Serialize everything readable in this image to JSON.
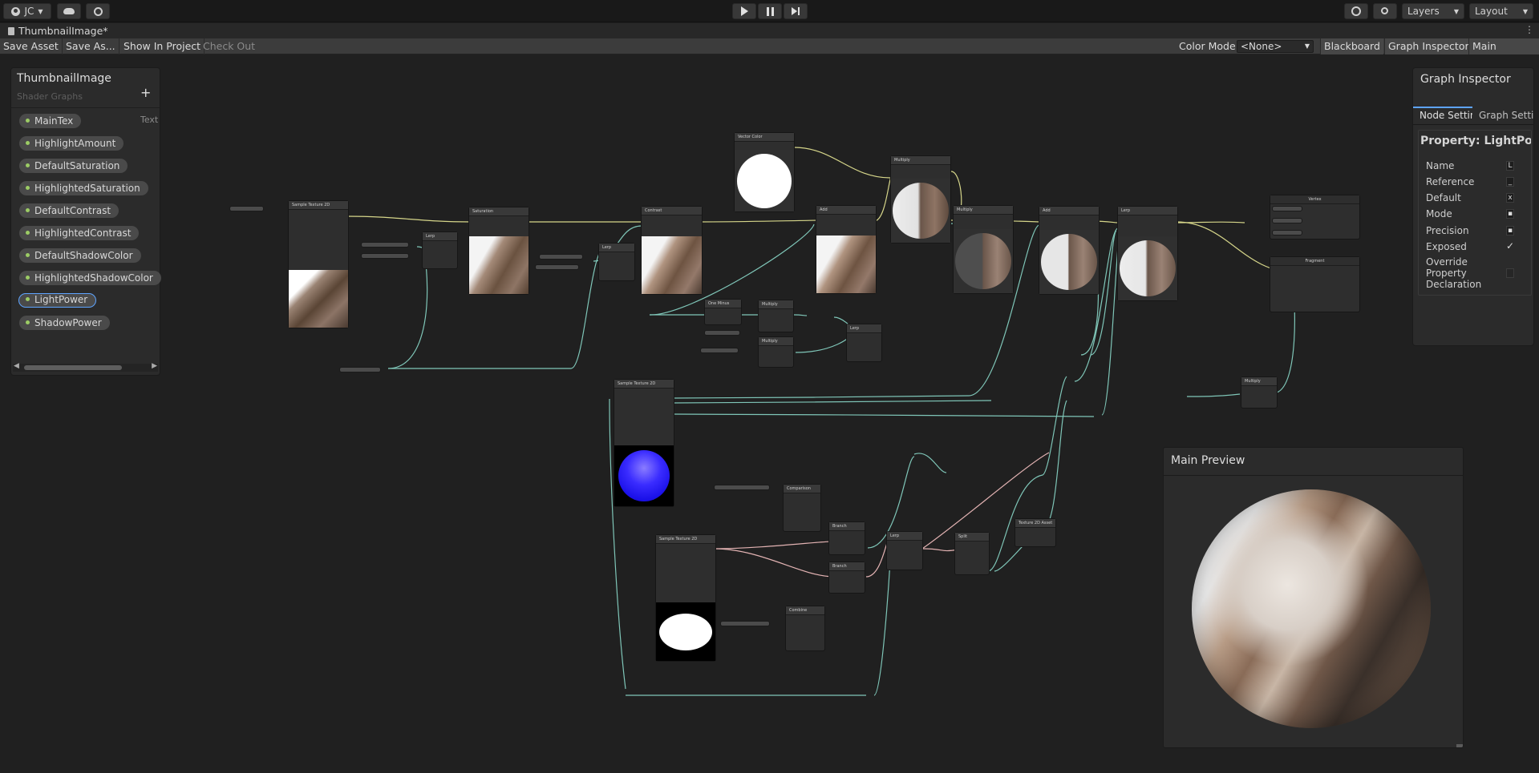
{
  "topbar": {
    "account": "JC",
    "layers": "Layers",
    "layout": "Layout"
  },
  "tab": {
    "title": "ThumbnailImage*"
  },
  "toolbar": {
    "save_asset": "Save Asset",
    "save_as": "Save As...",
    "show_in_project": "Show In Project",
    "check_out": "Check Out",
    "color_mode_label": "Color Mode",
    "color_mode_value": "<None>",
    "blackboard": "Blackboard",
    "graph_inspector": "Graph Inspector",
    "main_preview": "Main Preview"
  },
  "blackboard": {
    "title": "ThumbnailImage",
    "subtitle": "Shader Graphs",
    "type_hint": "Text",
    "properties": [
      "MainTex",
      "HighlightAmount",
      "DefaultSaturation",
      "HighlightedSaturation",
      "DefaultContrast",
      "HighlightedContrast",
      "DefaultShadowColor",
      "HighlightedShadowColor",
      "LightPower",
      "ShadowPower"
    ],
    "selected": "LightPower"
  },
  "inspector": {
    "title": "Graph Inspector",
    "tabs": [
      "Node Settings",
      "Graph Settings"
    ],
    "property_title": "Property: LightPower",
    "rows": [
      "Name",
      "Reference",
      "Default",
      "Mode",
      "Precision",
      "Exposed",
      "Override Property Declaration"
    ],
    "values": [
      "L",
      "_",
      "x",
      "▪",
      "▪",
      "✓",
      ""
    ]
  },
  "preview": {
    "title": "Main Preview"
  },
  "colors": {
    "accent": "#5ea4ff",
    "wire_vector": "#d6d68a",
    "wire_float": "#7fc6b8",
    "wire_color": "#e3b3b3",
    "property_dot": "#9ccc65"
  },
  "nodes": [
    {
      "id": "sampletex1",
      "title": "Sample Texture 2D"
    },
    {
      "id": "lerp1",
      "title": "Lerp"
    },
    {
      "id": "saturation",
      "title": "Saturation"
    },
    {
      "id": "lerp2",
      "title": "Lerp"
    },
    {
      "id": "contrast",
      "title": "Contrast"
    },
    {
      "id": "vectorcolor",
      "title": "Vector Color"
    },
    {
      "id": "add1",
      "title": "Add"
    },
    {
      "id": "multiply1",
      "title": "Multiply"
    },
    {
      "id": "multiply2",
      "title": "Multiply"
    },
    {
      "id": "add2",
      "title": "Add"
    },
    {
      "id": "lerp3",
      "title": "Lerp"
    },
    {
      "id": "oneminus",
      "title": "One Minus"
    },
    {
      "id": "multiply3",
      "title": "Multiply"
    },
    {
      "id": "multiply4",
      "title": "Multiply"
    },
    {
      "id": "lerp4",
      "title": "Lerp"
    },
    {
      "id": "sampletex2",
      "title": "Sample Texture 2D"
    },
    {
      "id": "vertex",
      "title": "Vertex"
    },
    {
      "id": "fragment",
      "title": "Fragment"
    },
    {
      "id": "multiply5",
      "title": "Multiply"
    },
    {
      "id": "comparison1",
      "title": "Comparison"
    },
    {
      "id": "branch1",
      "title": "Branch"
    },
    {
      "id": "branch2",
      "title": "Branch"
    },
    {
      "id": "sampletex3",
      "title": "Sample Texture 2D"
    },
    {
      "id": "combine",
      "title": "Combine"
    },
    {
      "id": "lerp5",
      "title": "Lerp"
    },
    {
      "id": "split",
      "title": "Split"
    },
    {
      "id": "tex2dasset",
      "title": "Texture 2D Asset"
    }
  ]
}
